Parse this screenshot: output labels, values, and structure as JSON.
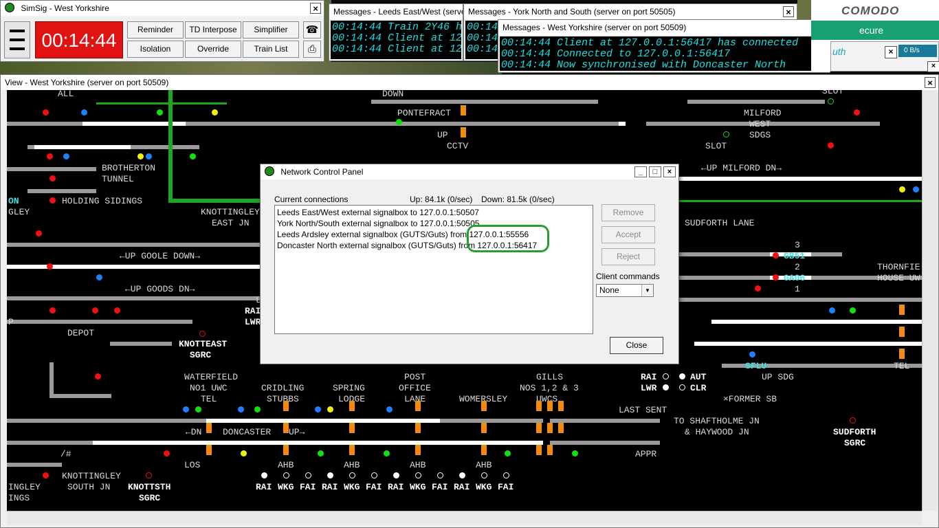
{
  "simsig": {
    "title": "SimSig - West Yorkshire",
    "clock": "00:14:44",
    "buttons": [
      "Reminder",
      "TD Interpose",
      "Simplifier",
      "Isolation",
      "Override",
      "Train List"
    ]
  },
  "messages_leeds": {
    "title": "Messages - Leeds East/West (server on port 50509)",
    "lines": [
      "00:14:44 Train 2Y46 h",
      "00:14:44 Client at 12",
      "00:14:44 Client at 12"
    ]
  },
  "messages_york": {
    "title": "Messages - York North and South (server on port 50505)",
    "lines": [
      "00:14:44",
      "00:14:44",
      "00:14:44"
    ]
  },
  "messages_wy": {
    "title": "Messages - West Yorkshire (server on port 50509)",
    "lines": [
      "00:14:44 Client at 127.0.0.1:56417 has connected",
      "00:14:44 Connected to 127.0.0.1:56417",
      "00:14:44 Now synchronised with Doncaster North"
    ]
  },
  "comodo": {
    "logo": "COMODO",
    "banner": "ecure",
    "side": "uth",
    "rate": "0 B/s"
  },
  "view": {
    "title": "View - West Yorkshire (server on port 50509)",
    "labels": {
      "pontefract": "PONTEFRACT",
      "up": "UP",
      "cctv": "CCTV",
      "brotherton": "BROTHERTON",
      "tunnel": "TUNNEL",
      "holding": "HOLDING SIDINGS",
      "gley": "GLEY",
      "on": "ON",
      "knottingley_east": "KNOTTINGLEY",
      "east_jn": "EAST JN",
      "up_goole_down": "←UP GOOLE DOWN→",
      "up_goods_dn": "←UP GOODS DN→",
      "depot": "DEPOT",
      "knotteast": "KNOTTEAST",
      "sgrc": "SGRC",
      "waterfield": "WATERFIELD",
      "no1uwc": "NO1 UWC",
      "tel": "TEL",
      "cridling": "CRIDLING",
      "stubbs": "STUBBS",
      "spring": "SPRING",
      "lodge": "LODGE",
      "post": "POST",
      "office": "OFFICE",
      "lane": "LANE",
      "womersley": "WOMERSLEY",
      "gills": "GILLS",
      "nos": "NOS 1,2 & 3",
      "uwcs": "UWCS",
      "dn": "←DN",
      "doncaster": "DONCASTER",
      "upr": "UP→",
      "los": "LOS",
      "ahb": "AHB",
      "knottingley_south": "KNOTTINGLEY",
      "south_jn": "SOUTH JN",
      "knottsth": "KNOTTSTH",
      "ingley": "INGLEY",
      "ings": "INGS",
      "milford": "MILFORD",
      "west": "WEST",
      "sdgs": "SDGS",
      "slot": "SLOT",
      "up_milford_dn": "←UP MILFORD DN→",
      "sudforth_lane": "SUDFORTH LANE",
      "gb51": "GB51",
      "ga06": "GA06",
      "three": "3",
      "two": "2",
      "one": "1",
      "thornfie": "THORNFIE",
      "house_uw": "HOUSE UW",
      "sflu": "SFLU",
      "up_sdg": "UP SDG",
      "tel2": "TEL",
      "rai": "RAI",
      "lwr": "LWR",
      "aut": "AUT",
      "clr": "CLR",
      "former_sb": "×FORMER SB",
      "last_sent": "LAST SENT",
      "to_shaftholme": "TO SHAFTHOLME JN",
      "haywood": "& HAYWOOD JN",
      "appr": "APPR",
      "sudforth": "SUDFORTH",
      "sudforth_sgrc": "SGRC",
      "all": "ALL",
      "down": "DOWN",
      "rai2": "RAI",
      "lwr2": "LWR",
      "p": "P",
      "l": "L",
      "hash": "/#",
      "bottom_codes": [
        "RAI",
        "WKG",
        "FAI",
        "RAI",
        "WKG",
        "FAI",
        "RAI",
        "WKG",
        "FAI",
        "RAI",
        "WKG",
        "FAI"
      ]
    }
  },
  "ncp": {
    "title": "Network Control Panel",
    "current_connections": "Current connections",
    "up_stat": "Up: 84.1k (0/sec)",
    "down_stat": "Down: 81.5k (0/sec)",
    "connections": [
      "Leeds East/West external signalbox to 127.0.0.1:50507",
      "York North/South external signalbox to 127.0.0.1:50505",
      "Leeds Ardsley external signalbox (GUTS/Guts) from 127.0.0.1:55556",
      "Doncaster North external signalbox (GUTS/Guts) from 127.0.0.1:56417"
    ],
    "buttons": {
      "remove": "Remove",
      "accept": "Accept",
      "reject": "Reject",
      "close": "Close"
    },
    "client_commands_label": "Client commands",
    "client_commands_value": "None"
  },
  "colors": {
    "clock_bg": "#e01212",
    "message_text": "#18e0e0",
    "highlight": "#22a030"
  }
}
